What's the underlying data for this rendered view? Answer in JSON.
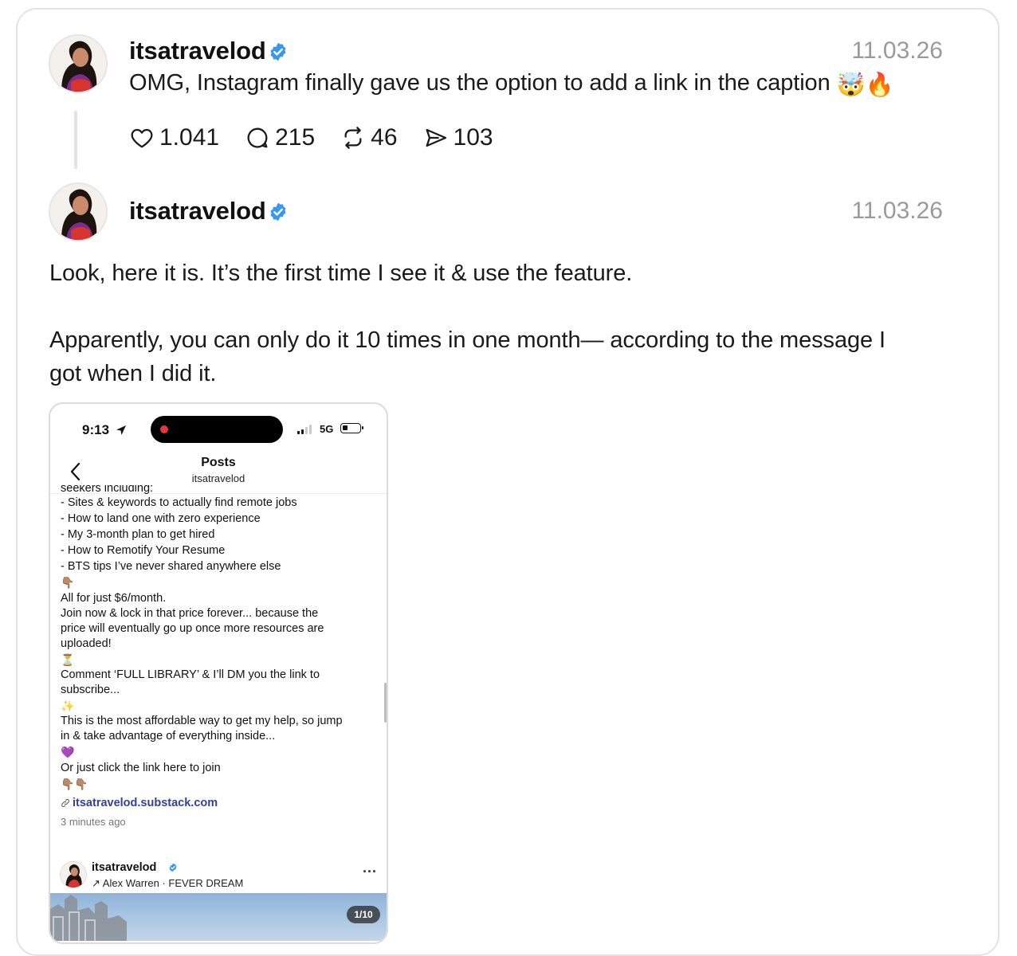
{
  "post1": {
    "username": "itsatravelod",
    "date": "11.03.26",
    "caption": "OMG, Instagram finally gave us the option to add a link in the caption",
    "caption_emoji": "🤯🔥",
    "likes": "1.041",
    "replies": "215",
    "reposts": "46",
    "shares": "103"
  },
  "post2": {
    "username": "itsatravelod",
    "date": "11.03.26",
    "paragraph1": "Look, here it is. It’s the first time I see it & use the feature.",
    "paragraph2_line1": "Apparently, you can only do it 10 times in one month— according to the message I",
    "paragraph2_line2": "got when I did it."
  },
  "screenshot": {
    "status_time": "9:13",
    "network": "5G",
    "nav_title": "Posts",
    "nav_subtitle": "itsatravelod",
    "lines": [
      "seekers including:",
      "- Sites & keywords to actually find remote jobs",
      "- How to land one with zero experience",
      "- My 3-month plan to get hired",
      "- How to Remotify Your Resume",
      "- BTS tips I’ve never shared anywhere else",
      "👇🏽",
      "All for just $6/month.",
      "Join now & lock in that price forever... because the",
      "price will eventually go up once more resources are",
      "uploaded!",
      "⏳",
      "Comment ‘FULL LIBRARY’ & I’ll DM you the link to",
      "subscribe...",
      "✨",
      "This is the most affordable way to get my help, so jump",
      "in & take advantage of everything inside...",
      "💜",
      "Or just click the link here to join",
      "👇🏽👇🏽"
    ],
    "link": "itsatravelod.substack.com",
    "time_ago": "3 minutes ago",
    "next_post_user": "itsatravelod",
    "next_post_music": "↗ Alex Warren · FEVER DREAM",
    "more": "...",
    "photo_counter": "1/10"
  },
  "colors": {
    "verified": "#3897f0",
    "link": "#34409a",
    "muted": "#9a9a9a"
  }
}
